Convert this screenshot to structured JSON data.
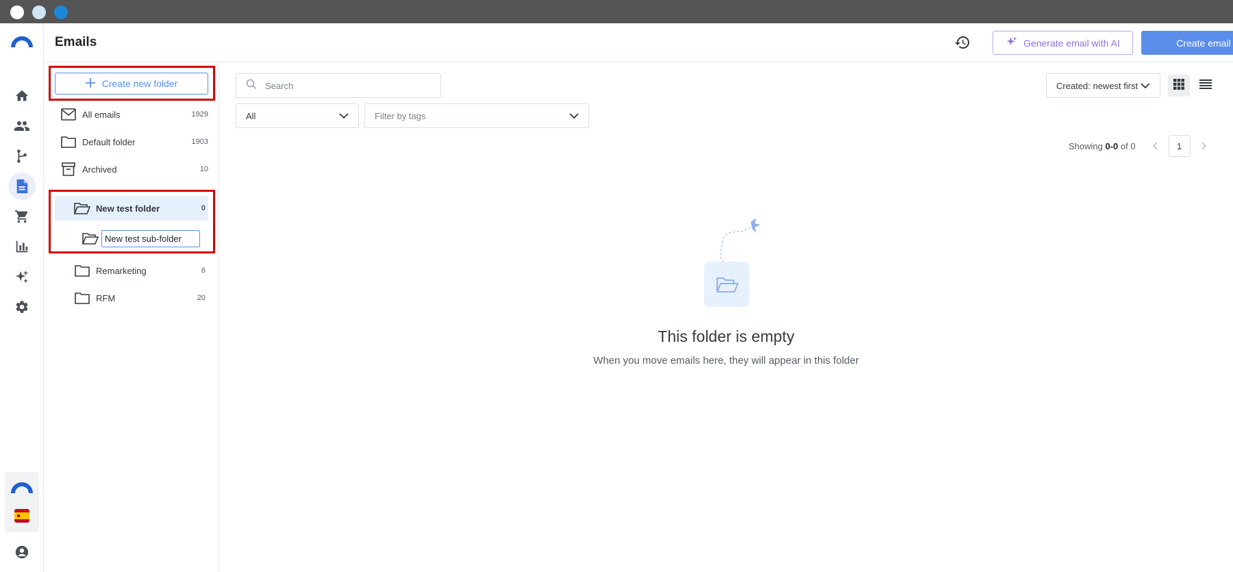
{
  "header": {
    "title": "Emails",
    "ai_button_label": "Generate email with AI",
    "create_email_label": "Create email"
  },
  "folders": {
    "create_new_label": "Create new folder",
    "items": [
      {
        "name": "All emails",
        "count": "1929",
        "icon": "mail-icon"
      },
      {
        "name": "Default folder",
        "count": "1903",
        "icon": "folder-icon"
      },
      {
        "name": "Archived",
        "count": "10",
        "icon": "archive-icon"
      },
      {
        "name": "New test folder",
        "count": "0",
        "icon": "folder-open-icon"
      },
      {
        "name": "Remarketing",
        "count": "6",
        "icon": "folder-icon"
      },
      {
        "name": "RFM",
        "count": "20",
        "icon": "folder-icon"
      }
    ],
    "subfolder_input_value": "New test sub-folder"
  },
  "filters": {
    "search_placeholder": "Search",
    "status_value": "All",
    "tags_placeholder": "Filter by tags",
    "sort_value": "Created: newest first"
  },
  "pagination": {
    "prefix": "Showing",
    "range": "0-0",
    "of_text": "of 0",
    "page": "1"
  },
  "empty_state": {
    "title": "This folder is empty",
    "subtitle": "When you move emails here, they will appear in this folder"
  },
  "colors": {
    "accent": "#5b8eea",
    "ai_purple": "#8d72e1",
    "highlight_red": "#d40000",
    "chrome_gray": "#555555"
  }
}
